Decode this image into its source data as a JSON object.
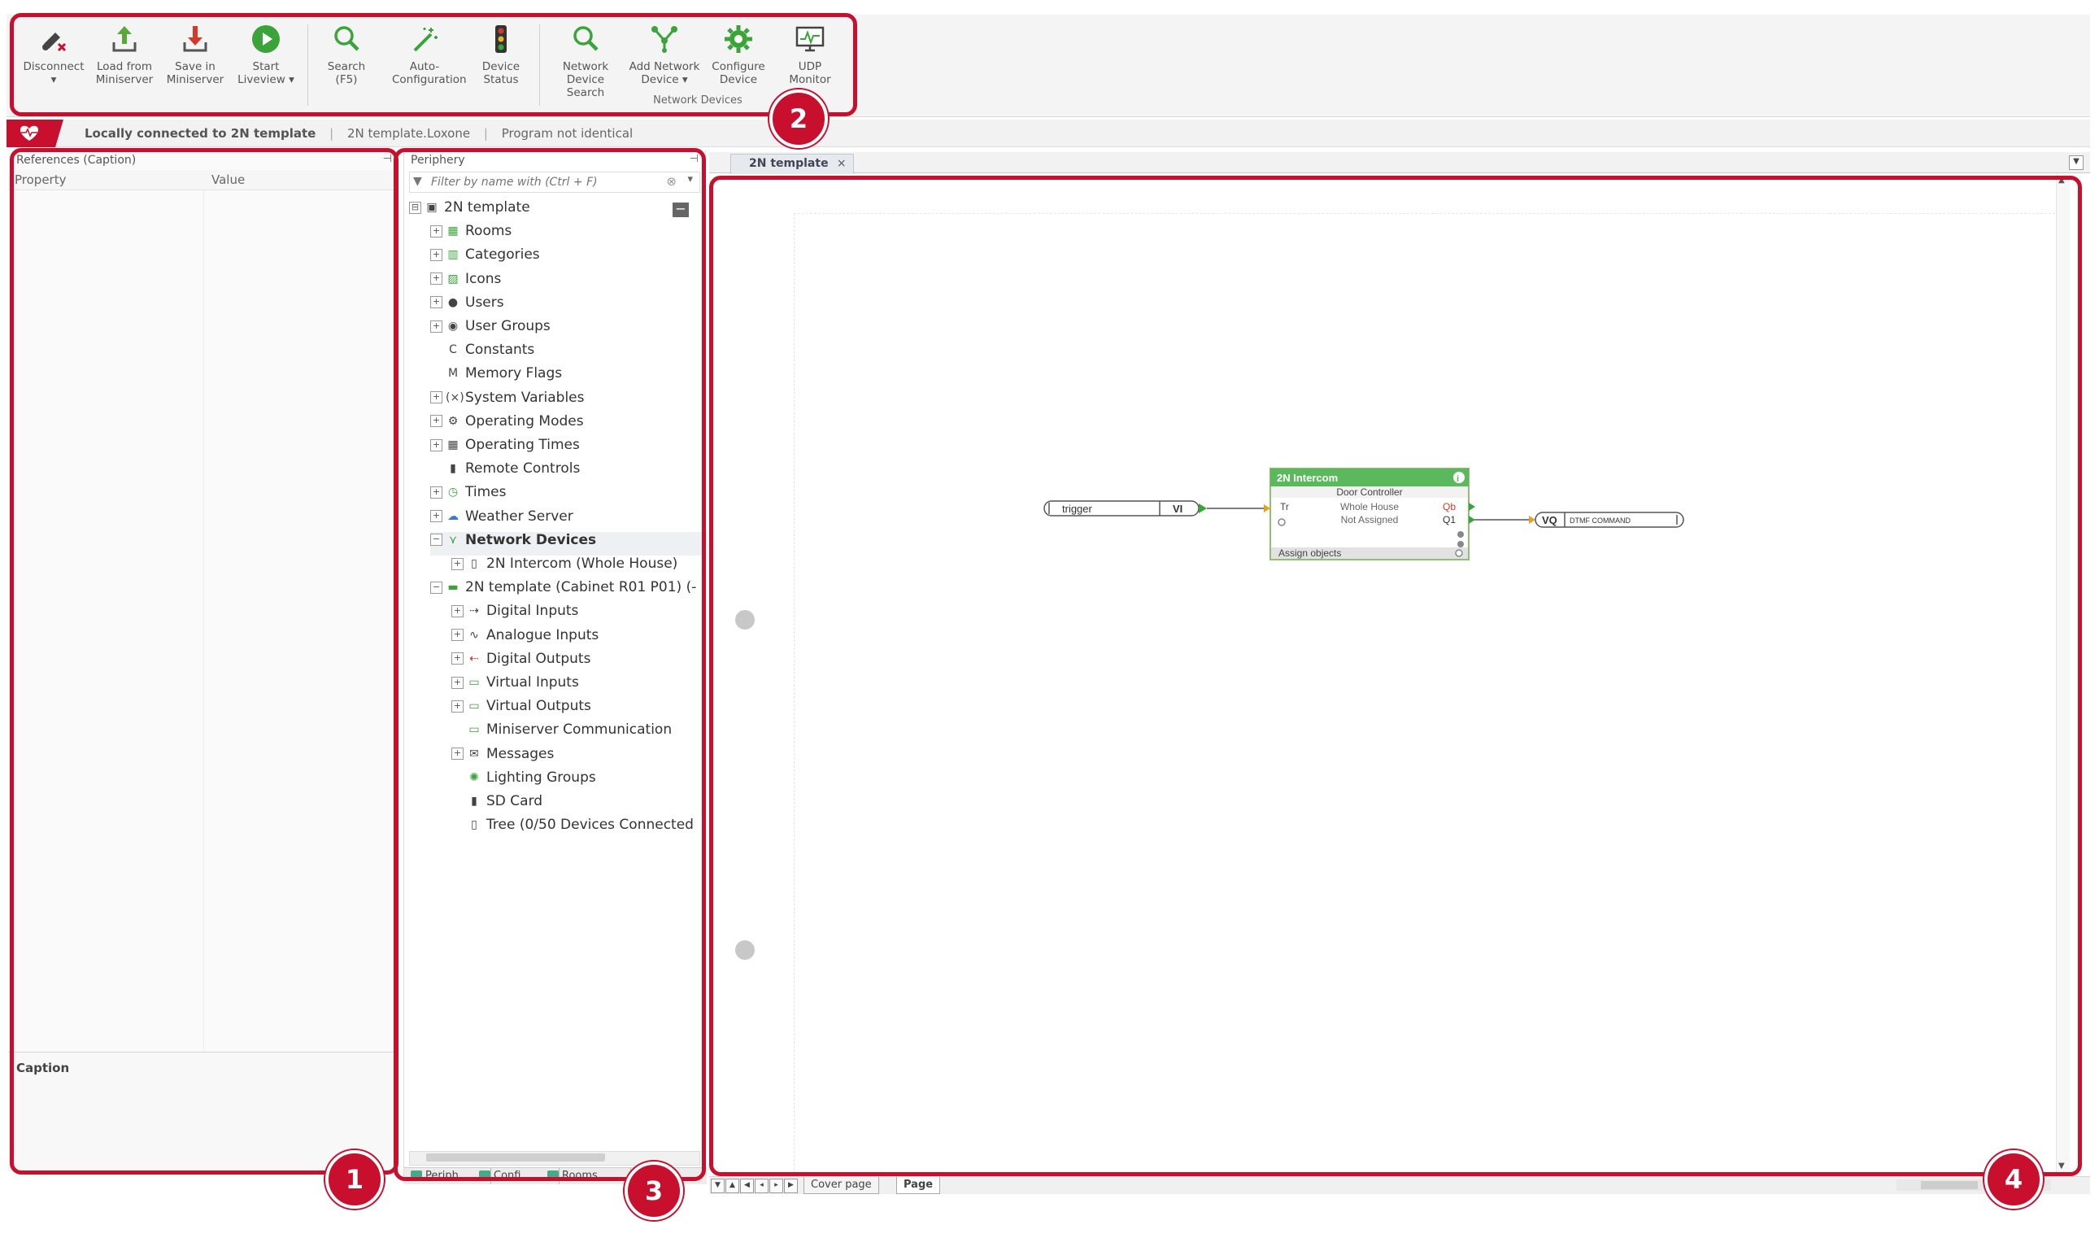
{
  "ribbon": {
    "buttons": [
      {
        "label": "Disconnect\n▾",
        "icon": "disconnect-icon"
      },
      {
        "label": "Load from\nMiniserver",
        "icon": "upload-icon"
      },
      {
        "label": "Save in\nMiniserver",
        "icon": "download-icon"
      },
      {
        "label": "Start\nLiveview ▾",
        "icon": "play-icon"
      },
      {
        "label": "Search\n(F5)",
        "icon": "search-icon"
      },
      {
        "label": "Auto-\nConfiguration",
        "icon": "magic-wand-icon"
      },
      {
        "label": "Device\nStatus",
        "icon": "traffic-light-icon"
      },
      {
        "label": "Network\nDevice Search",
        "icon": "search-icon"
      },
      {
        "label": "Add Network\nDevice ▾",
        "icon": "network-icon"
      },
      {
        "label": "Configure\nDevice",
        "icon": "gear-icon"
      },
      {
        "label": "UDP\nMonitor",
        "icon": "monitor-icon"
      }
    ],
    "group_label": "Network Devices"
  },
  "status": {
    "connection": "Locally connected to 2N template",
    "file": "2N template.Loxone",
    "program": "Program not identical"
  },
  "left_panel": {
    "title": "References (Caption)",
    "col_property": "Property",
    "col_value": "Value",
    "caption": "Caption"
  },
  "periphery": {
    "title": "Periphery",
    "filter_placeholder": "Filter by name with (Ctrl + F)",
    "tree": [
      {
        "label": "2N template",
        "icon": "project-icon",
        "level": 0,
        "ex": "⊟"
      },
      {
        "label": "Rooms",
        "icon": "rooms-icon",
        "level": 1,
        "ex": "+"
      },
      {
        "label": "Categories",
        "icon": "categories-icon",
        "level": 1,
        "ex": "+"
      },
      {
        "label": "Icons",
        "icon": "image-icon",
        "level": 1,
        "ex": "+"
      },
      {
        "label": "Users",
        "icon": "user-icon",
        "level": 1,
        "ex": "+"
      },
      {
        "label": "User Groups",
        "icon": "user-group-icon",
        "level": 1,
        "ex": "+"
      },
      {
        "label": "Constants",
        "icon": "constant-icon",
        "level": 1,
        "ex": ""
      },
      {
        "label": "Memory Flags",
        "icon": "memory-flag-icon",
        "level": 1,
        "ex": ""
      },
      {
        "label": "System Variables",
        "icon": "variable-icon",
        "level": 1,
        "ex": "+"
      },
      {
        "label": "Operating Modes",
        "icon": "gear-icon",
        "level": 1,
        "ex": "+"
      },
      {
        "label": "Operating Times",
        "icon": "calendar-icon",
        "level": 1,
        "ex": "+"
      },
      {
        "label": "Remote Controls",
        "icon": "remote-icon",
        "level": 1,
        "ex": ""
      },
      {
        "label": "Times",
        "icon": "clock-icon",
        "level": 1,
        "ex": "+"
      },
      {
        "label": "Weather Server",
        "icon": "weather-icon",
        "level": 1,
        "ex": "+"
      },
      {
        "label": "Network Devices",
        "icon": "network-icon",
        "level": 1,
        "ex": "−"
      },
      {
        "label": "2N Intercom (Whole House)",
        "icon": "intercom-icon",
        "level": 2,
        "ex": "+"
      },
      {
        "label": "2N template (Cabinet R01 P01) (-",
        "icon": "miniserver-icon",
        "level": 1,
        "ex": "−"
      },
      {
        "label": "Digital Inputs",
        "icon": "digital-input-icon",
        "level": 2,
        "ex": "+"
      },
      {
        "label": "Analogue Inputs",
        "icon": "analog-input-icon",
        "level": 2,
        "ex": "+"
      },
      {
        "label": "Digital Outputs",
        "icon": "digital-output-icon",
        "level": 2,
        "ex": "+"
      },
      {
        "label": "Virtual Inputs",
        "icon": "virtual-input-icon",
        "level": 2,
        "ex": "+"
      },
      {
        "label": "Virtual Outputs",
        "icon": "virtual-output-icon",
        "level": 2,
        "ex": "+"
      },
      {
        "label": "Miniserver Communication",
        "icon": "communication-icon",
        "level": 2,
        "ex": ""
      },
      {
        "label": "Messages",
        "icon": "message-icon",
        "level": 2,
        "ex": "+"
      },
      {
        "label": "Lighting Groups",
        "icon": "lighting-icon",
        "level": 2,
        "ex": ""
      },
      {
        "label": "SD Card",
        "icon": "sd-card-icon",
        "level": 2,
        "ex": ""
      },
      {
        "label": "Tree  (0/50 Devices Connected",
        "icon": "tree-icon",
        "level": 2,
        "ex": ""
      }
    ],
    "tabs": [
      "Periph",
      "Confi",
      "Rooms"
    ]
  },
  "document": {
    "tab": "2N template",
    "tab_close": "×",
    "pages": [
      "Cover page",
      "Page"
    ]
  },
  "diagram": {
    "input_label": "trigger",
    "input_type": "VI",
    "block_title": "2N Intercom",
    "block_subtitle": "Door Controller",
    "block_in": "Tr",
    "block_room": "Whole House",
    "block_cat": "Not Assigned",
    "block_out1": "Qb",
    "block_out2": "Q1",
    "block_footer": "Assign objects",
    "output_type": "VQ",
    "output_label": "DTMF COMMAND"
  },
  "callouts": [
    "1",
    "2",
    "3",
    "4"
  ],
  "colors": {
    "accent": "#c8102e",
    "green": "#5cb85c"
  }
}
